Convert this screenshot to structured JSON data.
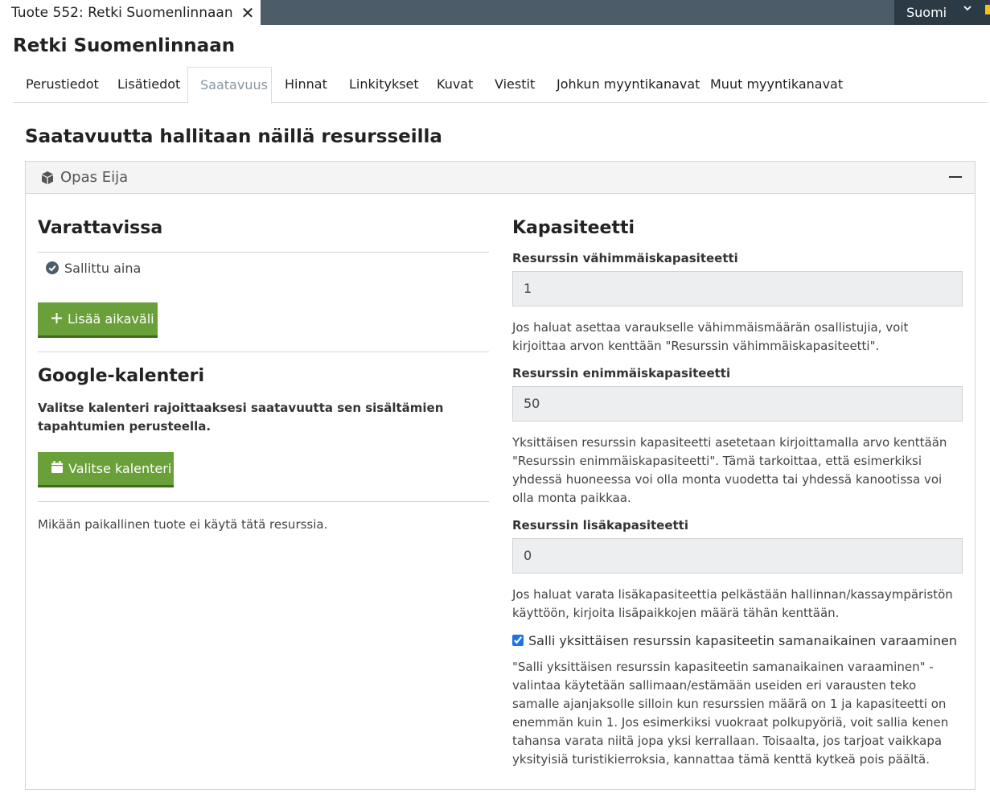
{
  "window": {
    "tab_title": "Tuote 552: Retki Suomenlinnaan",
    "language": "Suomi"
  },
  "page": {
    "title": "Retki Suomenlinnaan"
  },
  "tabs": [
    {
      "label": "Perustiedot"
    },
    {
      "label": "Lisätiedot"
    },
    {
      "label": "Saatavuus"
    },
    {
      "label": "Hinnat"
    },
    {
      "label": "Linkitykset"
    },
    {
      "label": "Kuvat"
    },
    {
      "label": "Viestit"
    },
    {
      "label": "Johkun myyntikanavat"
    },
    {
      "label": "Muut myyntikanavat"
    }
  ],
  "active_tab": "Saatavuus",
  "section_title": "Saatavuutta hallitaan näillä resursseilla",
  "resource": {
    "name": "Opas Eija",
    "availability": {
      "title": "Varattavissa",
      "status": "Sallittu aina",
      "add_button": "Lisää aikaväli"
    },
    "google": {
      "title": "Google-kalenteri",
      "description": "Valitse kalenteri rajoittaaksesi saatavuutta sen sisältämien tapahtumien perusteella.",
      "button": "Valitse kalenteri"
    },
    "local_note": "Mikään paikallinen tuote ei käytä tätä resurssia.",
    "capacity": {
      "title": "Kapasiteetti",
      "min_label": "Resurssin vähimmäiskapasiteetti",
      "min_value": "1",
      "min_help": "Jos haluat asettaa varaukselle vähimmäismäärän osallistujia, voit kirjoittaa arvon kenttään \"Resurssin vähimmäiskapasiteetti\".",
      "max_label": "Resurssin enimmäiskapasiteetti",
      "max_value": "50",
      "max_help": "Yksittäisen resurssin kapasiteetti asetetaan kirjoittamalla arvo kenttään \"Resurssin enimmäiskapasiteetti\". Tämä tarkoittaa, että esimerkiksi yhdessä huoneessa voi olla monta vuodetta tai yhdessä kanootissa voi olla monta paikkaa.",
      "extra_label": "Resurssin lisäkapasiteetti",
      "extra_value": "0",
      "extra_help": "Jos haluat varata lisäkapasiteettia pelkästään hallinnan/kassaympäristön käyttöön, kirjoita lisäpaikkojen määrä tähän kenttään.",
      "concurrent_label": "Salli yksittäisen resurssin kapasiteetin samanaikainen varaaminen",
      "concurrent_checked": true,
      "concurrent_help": "\"Salli yksittäisen resurssin kapasiteetin samanaikainen varaaminen\" -valintaa käytetään sallimaan/estämään useiden eri varausten teko samalle ajanjaksolle silloin kun resurssien määrä on 1 ja kapasiteetti on enemmän kuin 1. Jos esimerkiksi vuokraat polkupyöriä, voit sallia kenen tahansa varata niitä jopa yksi kerrallaan. Toisaalta, jos tarjoat vaikkapa yksityisiä turistikierroksia, kannattaa tämä kenttä kytkeä pois päältä."
    }
  },
  "colors": {
    "topbar": "#4d5c69",
    "button_green": "#6aa03a",
    "active_tab_text": "#8a97a3"
  }
}
